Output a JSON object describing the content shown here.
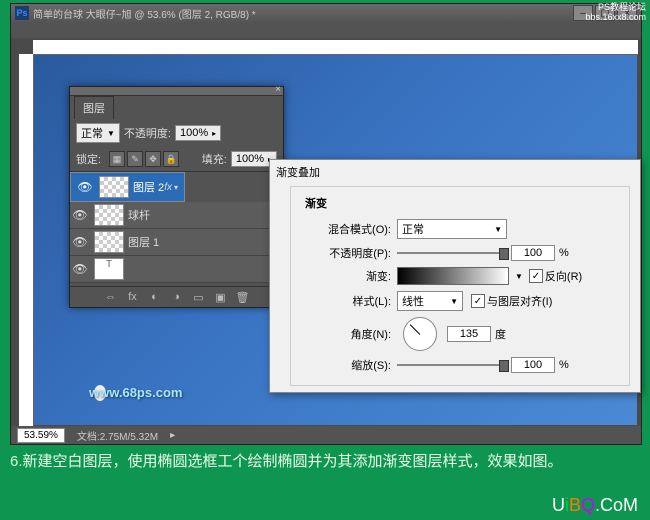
{
  "window": {
    "title": "简单的台球  大眼仔~旭 @ 53.6% (图层 2, RGB/8) *",
    "badge_line1": "PS教程论坛",
    "badge_line2": "bbs.16xx8.com"
  },
  "layers_panel": {
    "tab": "图层",
    "blend_mode": "正常",
    "opacity_label": "不透明度:",
    "opacity_value": "100%",
    "lock_label": "锁定:",
    "fill_label": "填充:",
    "fill_value": "100%",
    "items": [
      {
        "name": "图层 2",
        "selected": true,
        "fx": true
      },
      {
        "name": "球杆",
        "selected": false,
        "fx": false
      },
      {
        "name": "图层 1",
        "selected": false,
        "fx": false
      }
    ]
  },
  "dialog": {
    "title": "渐变叠加",
    "section": "渐变",
    "blend_label": "混合模式(O):",
    "blend_value": "正常",
    "opacity_label": "不透明度(P):",
    "opacity_value": "100",
    "percent": "%",
    "gradient_label": "渐变:",
    "reverse": "反向(R)",
    "style_label": "样式(L):",
    "style_value": "线性",
    "align": "与图层对齐(I)",
    "angle_label": "角度(N):",
    "angle_value": "135",
    "angle_unit": "度",
    "scale_label": "缩放(S):",
    "scale_value": "100"
  },
  "status": {
    "zoom": "53.59%",
    "docinfo": "文档:2.75M/5.32M"
  },
  "watermark": "www.68ps.com",
  "caption_num": "6.",
  "caption_text": "新建空白图层，使用椭圆选框工个绘制椭圆并为其添加渐变图层样式，效果如图。",
  "ubq": "UiBQ.CoM"
}
